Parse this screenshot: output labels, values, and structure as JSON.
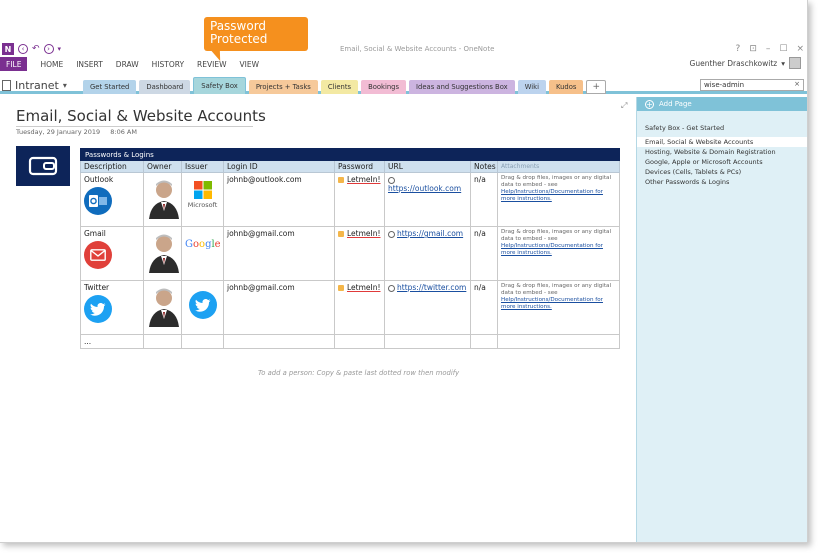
{
  "window": {
    "title": "Email, Social & Website Accounts - OneNote",
    "user_name": "Guenther Draschkowitz",
    "controls": [
      "?",
      "⊡",
      "–",
      "☐",
      "×"
    ]
  },
  "ribbon": {
    "file_label": "FILE",
    "tabs": [
      "HOME",
      "INSERT",
      "DRAW",
      "HISTORY",
      "REVIEW",
      "VIEW"
    ]
  },
  "notebook": {
    "name": "Intranet"
  },
  "section_tabs": [
    {
      "label": "Get Started",
      "color": "#b3d3ea"
    },
    {
      "label": "Dashboard",
      "color": "#cdd8e4"
    },
    {
      "label": "Safety Box",
      "color": "#a6d6dc",
      "active": true
    },
    {
      "label": "Projects + Tasks",
      "color": "#f6c99a"
    },
    {
      "label": "Clients",
      "color": "#f3e9a3"
    },
    {
      "label": "Bookings",
      "color": "#f2bcd4"
    },
    {
      "label": "Ideas and Suggestions Box",
      "color": "#ccb4e0"
    },
    {
      "label": "Wiki",
      "color": "#bcd3ee"
    },
    {
      "label": "Kudos",
      "color": "#f6c08a"
    }
  ],
  "add_section_label": "+",
  "search": {
    "value": "wise-admin",
    "clear": "×"
  },
  "callout": {
    "text_line1": "Password",
    "text_line2": "Protected"
  },
  "page": {
    "title": "Email, Social & Website Accounts",
    "date": "Tuesday, 29 January 2019",
    "time": "8:06 AM",
    "table_title": "Passwords & Logins",
    "columns": [
      "Description",
      "Owner",
      "Issuer",
      "Login ID",
      "Password",
      "URL",
      "Notes",
      "Attachments"
    ],
    "rows": [
      {
        "description": "Outlook",
        "issuer": "Microsoft",
        "login_id": "johnb@outlook.com",
        "password": "LetmeIn!",
        "url": "https://outlook.com",
        "notes": "n/a",
        "attach_text": "Drag & drop files, images or any digital data to embed - see",
        "attach_link": "Help/Instructions/Documentation for more instructions."
      },
      {
        "description": "Gmail",
        "issuer": "Google",
        "login_id": "johnb@gmail.com",
        "password": "LetmeIn!",
        "url": "https://gmail.com",
        "notes": "n/a",
        "attach_text": "Drag & drop files, images or any digital data to embed - see",
        "attach_link": "Help/Instructions/Documentation for more instructions."
      },
      {
        "description": "Twitter",
        "issuer": "",
        "login_id": "johnb@gmail.com",
        "password": "LetmeIn!",
        "url": "https://twitter.com",
        "notes": "n/a",
        "attach_text": "Drag & drop files, images or any digital data to embed - see",
        "attach_link": "Help/Instructions/Documentation for more instructions."
      }
    ],
    "last_row_marker": "...",
    "hint": "To add a person: Copy & paste last dotted row then modify"
  },
  "page_pane": {
    "add_page_label": "Add Page",
    "pages": [
      "Safety Box - Get Started",
      "Email, Social & Website Accounts",
      "Hosting, Website & Domain Registration",
      "Google, Apple or Microsoft Accounts",
      "Devices (Cells, Tablets & PCs)",
      "Other Passwords & Logins"
    ]
  },
  "colors": {
    "brand_purple": "#7a2f90",
    "callout_orange": "#f5901e",
    "table_header_navy": "#0d2459",
    "pane_blue": "#7fc2d8"
  }
}
